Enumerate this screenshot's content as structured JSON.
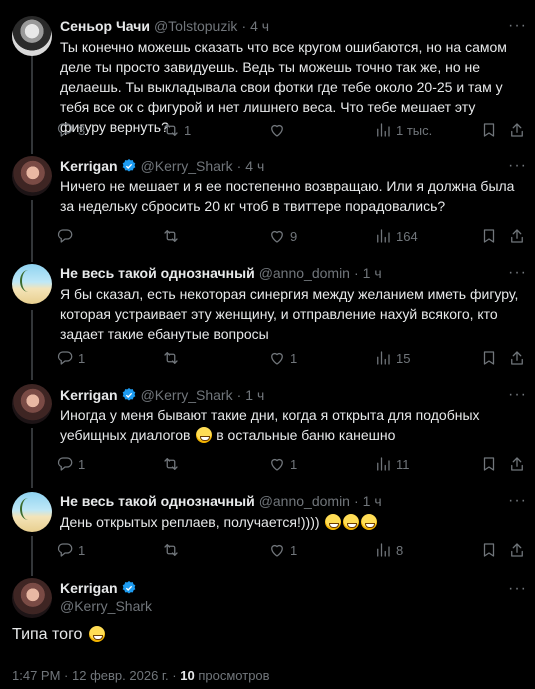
{
  "tweets": [
    {
      "name": "Сеньор Чачи",
      "handle": "@Tolstopuzik",
      "time": "4 ч",
      "text": "Ты конечно можешь сказать что все кругом ошибаются, но на самом деле ты просто завидуешь. Ведь ты можешь точно так же, но не делаешь. Ты выкладывала свои фотки где тебе около 20-25 и там у тебя все ок с фигурой и нет лишнего веса. Что тебе мешает эту фигуру вернуть?",
      "replies": "3",
      "retweets": "1",
      "likes": "",
      "views": "1 тыс."
    },
    {
      "name": "Kerrigan",
      "handle": "@Kerry_Shark",
      "time": "4 ч",
      "text": "Ничего не мешает и я ее постепенно возвращаю. Или я должна была за недельку сбросить 20 кг чтоб в твиттере порадовались?",
      "replies": "",
      "retweets": "",
      "likes": "9",
      "views": "164"
    },
    {
      "name": "Не весь такой однозначный",
      "handle": "@anno_domin",
      "time": "1 ч",
      "text": "Я бы сказал, есть некоторая синергия между желанием иметь фигуру, которая  устраивает эту женщину,  и отправление нахуй всякого, кто задает такие ебанутые вопросы",
      "replies": "1",
      "retweets": "",
      "likes": "1",
      "views": "15"
    },
    {
      "name": "Kerrigan",
      "handle": "@Kerry_Shark",
      "time": "1 ч",
      "text": "Иногда у меня бывают такие дни, когда я открыта для подобных уебищных диалогов",
      "text_tail": "в остальные баню канешно",
      "replies": "1",
      "retweets": "",
      "likes": "1",
      "views": "11"
    },
    {
      "name": "Не весь такой однозначный",
      "handle": "@anno_domin",
      "time": "1 ч",
      "text": "День открытых реплаев, получается!))))",
      "replies": "1",
      "retweets": "",
      "likes": "1",
      "views": "8"
    }
  ],
  "main": {
    "name": "Kerrigan",
    "handle": "@Kerry_Shark",
    "text": "Типа того",
    "time": "1:47 PM",
    "date": "12 февр. 2026 г.",
    "views_count": "10",
    "views_label": "просмотров",
    "separator": "·"
  },
  "dot": "·",
  "more_glyph": "···",
  "icons": [
    "reply-icon",
    "retweet-icon",
    "like-icon",
    "views-icon",
    "bookmark-icon",
    "share-icon",
    "grok-icon",
    "verified-badge-icon",
    "more-icon"
  ],
  "colors": {
    "background": "#000000",
    "text": "#e7e9ea",
    "muted": "#71767b",
    "verified": "#1d9bf0",
    "divider": "#2f3336"
  }
}
